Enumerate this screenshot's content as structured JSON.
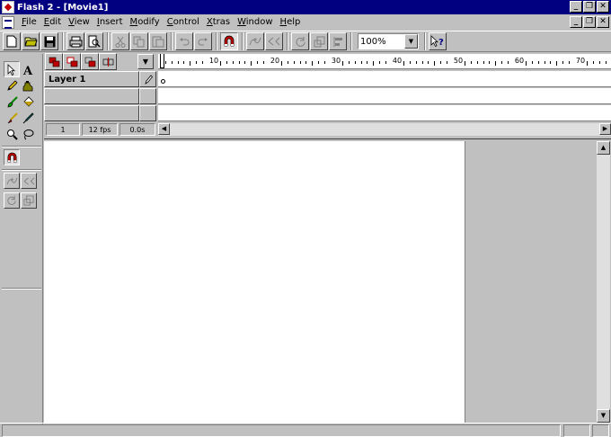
{
  "window": {
    "title": "Flash 2 - [Movie1]",
    "minimize": "_",
    "restore": "❐",
    "close": "✕"
  },
  "menubar": {
    "items": [
      {
        "first": "F",
        "rest": "ile"
      },
      {
        "first": "E",
        "rest": "dit"
      },
      {
        "first": "V",
        "rest": "iew"
      },
      {
        "first": "I",
        "rest": "nsert"
      },
      {
        "first": "M",
        "rest": "odify"
      },
      {
        "first": "C",
        "rest": "ontrol"
      },
      {
        "first": "X",
        "rest": "tras"
      },
      {
        "first": "W",
        "rest": "indow"
      },
      {
        "first": "H",
        "rest": "elp"
      }
    ]
  },
  "toolbar": {
    "zoom_value": "100%",
    "icons": [
      "new-file-icon",
      "open-folder-icon",
      "save-icon",
      "print-icon",
      "print-preview-icon",
      "cut-icon",
      "copy-icon",
      "paste-icon",
      "undo-icon",
      "redo-icon",
      "snap-magnet-icon",
      "smooth-icon",
      "straighten-icon",
      "rotate-icon",
      "scale-icon",
      "align-icon",
      "context-help-icon"
    ]
  },
  "timeline": {
    "layer_name": "Layer 1",
    "ruler_labels": [
      "10",
      "20",
      "30",
      "40",
      "50",
      "60",
      "70"
    ],
    "current_frame": "1",
    "frame_rate": "12 fps",
    "elapsed_time": "0.0s"
  },
  "colors": {
    "titlebar": "#000080",
    "face": "#c0c0c0",
    "stage": "#ffffff",
    "accent_red": "#c00000"
  }
}
